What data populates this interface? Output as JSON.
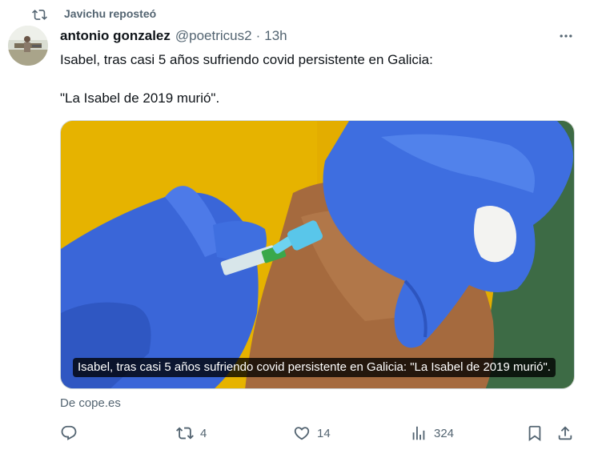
{
  "repost": {
    "label": "Javichu reposteó",
    "icon": "repost-icon"
  },
  "tweet": {
    "author_name": "antonio gonzalez",
    "handle": "@poetricus2",
    "separator": "·",
    "time": "13h",
    "lines": [
      "Isabel, tras casi 5 años sufriendo covid persistente en Galicia:",
      "\"La Isabel de 2019 murió\"."
    ],
    "more_icon": "more-icon"
  },
  "card": {
    "caption": "Isabel, tras casi 5 años sufriendo covid persistente en Galicia: \"La Isabel de 2019 murió\".",
    "image": "vaccine-injection-photo"
  },
  "source": "De cope.es",
  "actions": {
    "reply": {
      "icon": "reply-icon",
      "count": ""
    },
    "retweet": {
      "icon": "retweet-icon",
      "count": "4"
    },
    "like": {
      "icon": "heart-icon",
      "count": "14"
    },
    "views": {
      "icon": "views-icon",
      "count": "324"
    },
    "bookmark": {
      "icon": "bookmark-icon"
    },
    "share": {
      "icon": "share-icon"
    }
  },
  "colors": {
    "text": "#0f1419",
    "muted": "#536471",
    "border": "#cfd9de",
    "glove": "#3f6fe0",
    "background_yellow": "#e8b400"
  }
}
